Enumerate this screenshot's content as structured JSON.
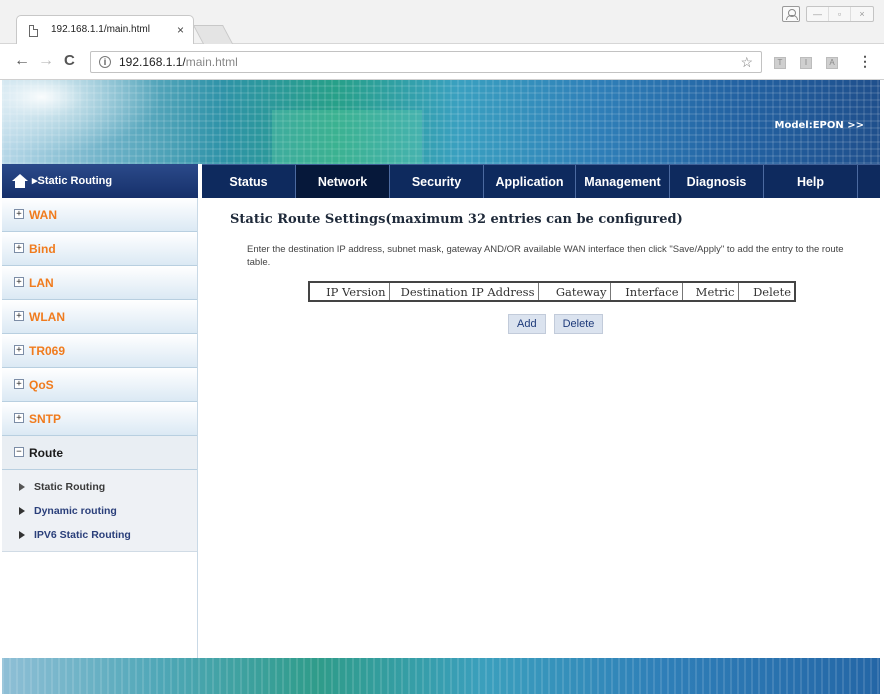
{
  "browser": {
    "tab_title": "192.168.1.1/main.html",
    "tab_close": "×",
    "url_host": "192.168.1.1/",
    "url_path": "main.html",
    "info_icon": "i",
    "back_icon": "←",
    "forward_icon": "→",
    "reload_icon": "C",
    "star_icon": "☆",
    "menu_icon": "⋮",
    "win_min": "—",
    "win_max": "▫",
    "win_close": "×",
    "ext_icons": [
      "T",
      "I",
      "A"
    ]
  },
  "banner": {
    "model": "Model:EPON >>"
  },
  "sidebar": {
    "breadcrumb": "▸Static Routing",
    "items": [
      {
        "toggle": "+",
        "label": "WAN"
      },
      {
        "toggle": "+",
        "label": "Bind"
      },
      {
        "toggle": "+",
        "label": "LAN"
      },
      {
        "toggle": "+",
        "label": "WLAN"
      },
      {
        "toggle": "+",
        "label": "TR069"
      },
      {
        "toggle": "+",
        "label": "QoS"
      },
      {
        "toggle": "+",
        "label": "SNTP"
      },
      {
        "toggle": "−",
        "label": "Route"
      }
    ],
    "subitems": [
      {
        "label": "Static Routing"
      },
      {
        "label": "Dynamic routing"
      },
      {
        "label": "IPV6 Static Routing"
      }
    ]
  },
  "nav": {
    "items": [
      {
        "label": "Status"
      },
      {
        "label": "Network"
      },
      {
        "label": "Security"
      },
      {
        "label": "Application"
      },
      {
        "label": "Management"
      },
      {
        "label": "Diagnosis"
      },
      {
        "label": "Help"
      }
    ]
  },
  "content": {
    "title": "Static Route Settings(maximum 32 entries can be configured)",
    "description": "Enter the destination IP address, subnet mask, gateway AND/OR available WAN interface then click \"Save/Apply\" to add the entry to the route table.",
    "table_headers": [
      "IP Version",
      "Destination IP Address",
      "Gateway",
      "Interface",
      "Metric",
      "Delete"
    ],
    "add_label": "Add",
    "delete_label": "Delete"
  }
}
